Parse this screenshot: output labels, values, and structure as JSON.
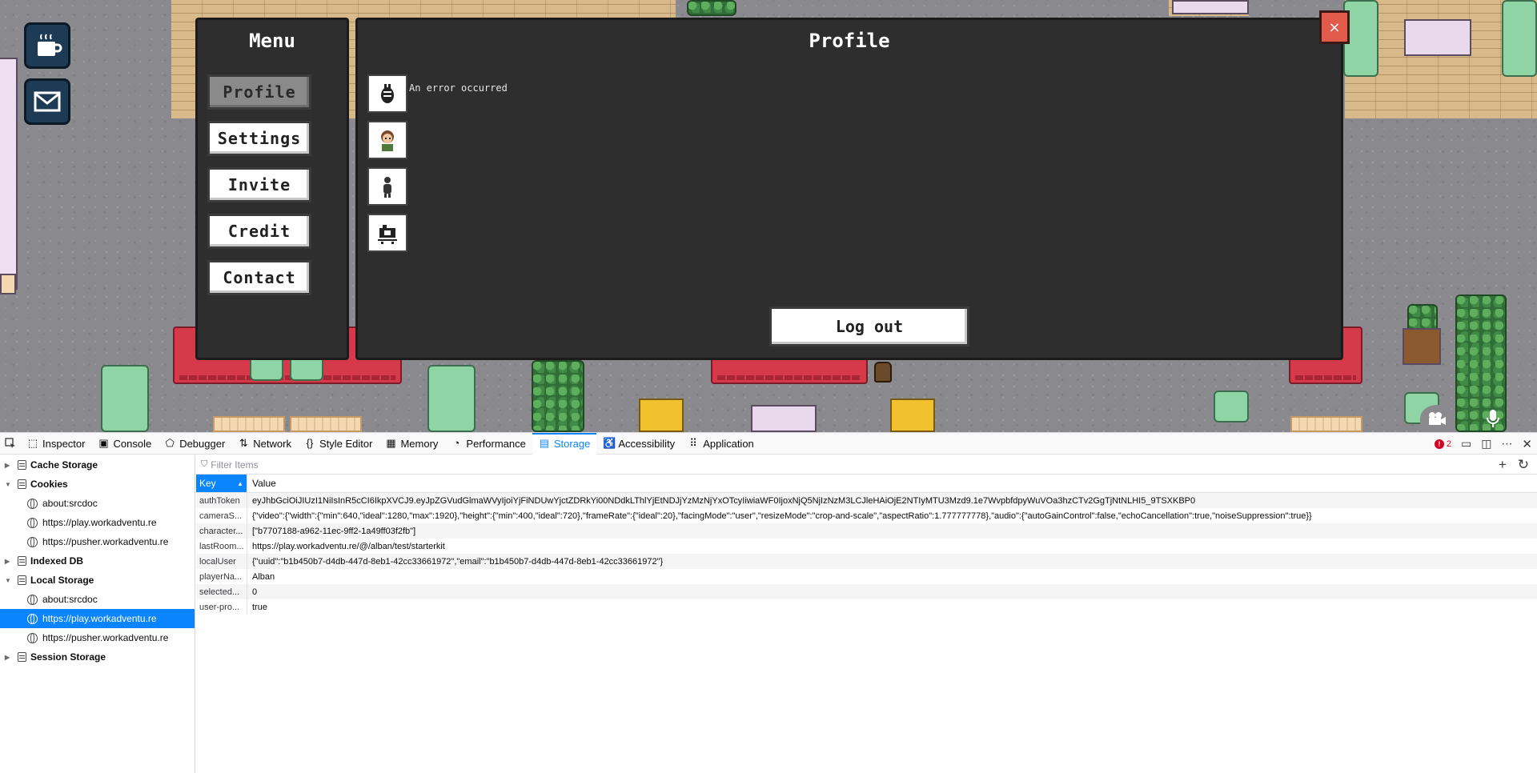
{
  "menu": {
    "title": "Menu",
    "items": [
      {
        "label": "Profile",
        "active": true
      },
      {
        "label": "Settings",
        "active": false
      },
      {
        "label": "Invite",
        "active": false
      },
      {
        "label": "Credit",
        "active": false
      },
      {
        "label": "Contact",
        "active": false
      }
    ]
  },
  "profile": {
    "title": "Profile",
    "error": "An error occurred",
    "logout_label": "Log out",
    "avatar_slots": [
      "companion-icon",
      "character-avatar-icon",
      "woka-figure-icon",
      "camera-settings-icon"
    ]
  },
  "close_label": "×",
  "game_buttons": [
    "coffee-cup-icon",
    "envelope-icon"
  ],
  "devtools": {
    "tabs": [
      {
        "label": "Inspector",
        "icon": "inspector-icon",
        "selected": false
      },
      {
        "label": "Console",
        "icon": "console-icon",
        "selected": false
      },
      {
        "label": "Debugger",
        "icon": "debugger-icon",
        "selected": false
      },
      {
        "label": "Network",
        "icon": "network-icon",
        "selected": false
      },
      {
        "label": "Style Editor",
        "icon": "style-editor-icon",
        "selected": false
      },
      {
        "label": "Memory",
        "icon": "memory-icon",
        "selected": false
      },
      {
        "label": "Performance",
        "icon": "performance-icon",
        "selected": false
      },
      {
        "label": "Storage",
        "icon": "storage-icon",
        "selected": true
      },
      {
        "label": "Accessibility",
        "icon": "accessibility-icon",
        "selected": false
      },
      {
        "label": "Application",
        "icon": "application-icon",
        "selected": false
      }
    ],
    "error_count": "2",
    "tree": {
      "cache_storage": "Cache Storage",
      "cookies": "Cookies",
      "cookies_children": [
        "about:srcdoc",
        "https://play.workadventu.re",
        "https://pusher.workadventu.re"
      ],
      "indexed_db": "Indexed DB",
      "local_storage": "Local Storage",
      "local_storage_children": [
        "about:srcdoc",
        "https://play.workadventu.re",
        "https://pusher.workadventu.re"
      ],
      "session_storage": "Session Storage"
    },
    "filter_placeholder": "Filter Items",
    "columns": {
      "key": "Key",
      "value": "Value"
    },
    "rows": [
      {
        "key": "authToken",
        "value": "eyJhbGciOiJIUzI1NiIsInR5cCI6IkpXVCJ9.eyJpZGVudGlmaWVyIjoiYjFiNDUwYjctZDRkYi00NDdkLThlYjEtNDJjYzMzNjYxOTcyIiwiaWF0IjoxNjQ5NjIzNzM3LCJleHAiOjE2NTIyMTU3Mzd9.1e7WvpbfdpyWuVOa3hzCTv2GgTjNtNLHI5_9TSXKBP0"
      },
      {
        "key": "cameraS...",
        "value": "{\"video\":{\"width\":{\"min\":640,\"ideal\":1280,\"max\":1920},\"height\":{\"min\":400,\"ideal\":720},\"frameRate\":{\"ideal\":20},\"facingMode\":\"user\",\"resizeMode\":\"crop-and-scale\",\"aspectRatio\":1.777777778},\"audio\":{\"autoGainControl\":false,\"echoCancellation\":true,\"noiseSuppression\":true}}"
      },
      {
        "key": "character...",
        "value": "[\"b7707188-a962-11ec-9ff2-1a49ff03f2fb\"]"
      },
      {
        "key": "lastRoom...",
        "value": "https://play.workadventu.re/@/alban/test/starterkit"
      },
      {
        "key": "localUser",
        "value": "{\"uuid\":\"b1b450b7-d4db-447d-8eb1-42cc33661972\",\"email\":\"b1b450b7-d4db-447d-8eb1-42cc33661972\"}"
      },
      {
        "key": "playerNa...",
        "value": "Alban"
      },
      {
        "key": "selected...",
        "value": "0"
      },
      {
        "key": "user-pro...",
        "value": "true"
      }
    ]
  }
}
